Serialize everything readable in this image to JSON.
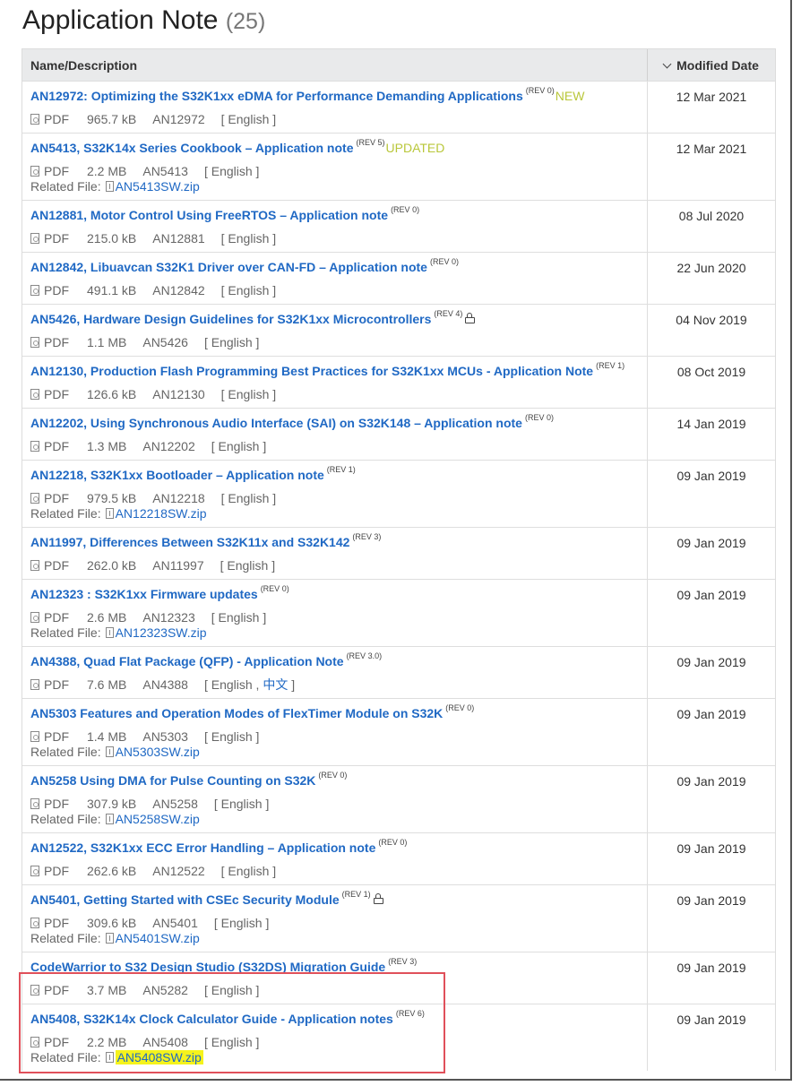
{
  "page": {
    "title": "Application Note",
    "count": "(25)"
  },
  "table": {
    "col_name": "Name/Description",
    "col_date": "Modified Date",
    "rows": [
      {
        "title": "AN12972: Optimizing the S32K1xx eDMA for Performance Demanding Applications",
        "rev": "(REV 0)",
        "badge": "NEW",
        "type": "PDF",
        "size": "965.7 kB",
        "code": "AN12972",
        "lang": "[ English ]",
        "related": "",
        "date": "12 Mar 2021"
      },
      {
        "title": "AN5413, S32K14x Series Cookbook – Application note",
        "rev": "(REV 5)",
        "badge": "UPDATED",
        "type": "PDF",
        "size": "2.2 MB",
        "code": "AN5413",
        "lang": "[ English ]",
        "related": "AN5413SW.zip",
        "date": "12 Mar 2021"
      },
      {
        "title": "AN12881, Motor Control Using FreeRTOS – Application note",
        "rev": "(REV 0)",
        "badge": "",
        "type": "PDF",
        "size": "215.0 kB",
        "code": "AN12881",
        "lang": "[ English ]",
        "related": "",
        "date": "08 Jul 2020"
      },
      {
        "title": "AN12842, Libuavcan S32K1 Driver over CAN-FD – Application note",
        "rev": "(REV 0)",
        "badge": "",
        "type": "PDF",
        "size": "491.1 kB",
        "code": "AN12842",
        "lang": "[ English ]",
        "related": "",
        "date": "22 Jun 2020"
      },
      {
        "title": "AN5426, Hardware Design Guidelines for S32K1xx Microcontrollers",
        "rev": "(REV 4)",
        "badge": "",
        "lock": true,
        "type": "PDF",
        "size": "1.1 MB",
        "code": "AN5426",
        "lang": "[ English ]",
        "related": "",
        "date": "04 Nov 2019"
      },
      {
        "title": "AN12130, Production Flash Programming Best Practices for S32K1xx MCUs - Application Note",
        "rev": "(REV 1)",
        "badge": "",
        "type": "PDF",
        "size": "126.6 kB",
        "code": "AN12130",
        "lang": "[ English ]",
        "related": "",
        "date": "08 Oct 2019"
      },
      {
        "title": "AN12202, Using Synchronous Audio Interface (SAI) on S32K148 – Application note",
        "rev": "(REV 0)",
        "badge": "",
        "type": "PDF",
        "size": "1.3 MB",
        "code": "AN12202",
        "lang": "[ English ]",
        "related": "",
        "date": "14 Jan 2019"
      },
      {
        "title": "AN12218, S32K1xx Bootloader – Application note",
        "rev": "(REV 1)",
        "badge": "",
        "type": "PDF",
        "size": "979.5 kB",
        "code": "AN12218",
        "lang": "[ English ]",
        "related": "AN12218SW.zip",
        "date": "09 Jan 2019"
      },
      {
        "title": "AN11997, Differences Between S32K11x and S32K142",
        "rev": "(REV 3)",
        "badge": "",
        "type": "PDF",
        "size": "262.0 kB",
        "code": "AN11997",
        "lang": "[ English ]",
        "related": "",
        "date": "09 Jan 2019"
      },
      {
        "title": "AN12323 : S32K1xx Firmware updates",
        "rev": "(REV 0)",
        "badge": "",
        "type": "PDF",
        "size": "2.6 MB",
        "code": "AN12323",
        "lang": "[ English ]",
        "related": "AN12323SW.zip",
        "date": "09 Jan 2019"
      },
      {
        "title": "AN4388, Quad Flat Package (QFP) - Application Note",
        "rev": "(REV 3.0)",
        "badge": "",
        "type": "PDF",
        "size": "7.6 MB",
        "code": "AN4388",
        "lang": "[ English ,",
        "lang_extra": "中文",
        "lang_close": "]",
        "related": "",
        "date": "09 Jan 2019"
      },
      {
        "title": "AN5303 Features and Operation Modes of FlexTimer Module on S32K",
        "rev": "(REV 0)",
        "badge": "",
        "type": "PDF",
        "size": "1.4 MB",
        "code": "AN5303",
        "lang": "[ English ]",
        "related": "AN5303SW.zip",
        "date": "09 Jan 2019"
      },
      {
        "title": "AN5258 Using DMA for Pulse Counting on S32K",
        "rev": "(REV 0)",
        "badge": "",
        "type": "PDF",
        "size": "307.9 kB",
        "code": "AN5258",
        "lang": "[ English ]",
        "related": "AN5258SW.zip",
        "date": "09 Jan 2019"
      },
      {
        "title": "AN12522, S32K1xx ECC Error Handling – Application note",
        "rev": "(REV 0)",
        "badge": "",
        "type": "PDF",
        "size": "262.6 kB",
        "code": "AN12522",
        "lang": "[ English ]",
        "related": "",
        "date": "09 Jan 2019"
      },
      {
        "title": "AN5401, Getting Started with CSEc Security Module",
        "rev": "(REV 1)",
        "badge": "",
        "lock": true,
        "type": "PDF",
        "size": "309.6 kB",
        "code": "AN5401",
        "lang": "[ English ]",
        "related": "AN5401SW.zip",
        "date": "09 Jan 2019"
      },
      {
        "title": "CodeWarrior to S32 Design Studio (S32DS) Migration Guide",
        "rev": "(REV 3)",
        "badge": "",
        "type": "PDF",
        "size": "3.7 MB",
        "code": "AN5282",
        "lang": "[ English ]",
        "related": "",
        "date": "09 Jan 2019"
      },
      {
        "title": "AN5408, S32K14x Clock Calculator Guide - Application notes",
        "rev": "(REV 6)",
        "badge": "",
        "type": "PDF",
        "size": "2.2 MB",
        "code": "AN5408",
        "lang": "[ English ]",
        "related": "AN5408SW.zip",
        "related_highlight": true,
        "date": "09 Jan 2019"
      }
    ],
    "related_label": "Related File:"
  },
  "colors": {
    "link": "#2069c4",
    "badge": "#b9c73a",
    "highlight": "#f5f31c",
    "callout_box": "#e0505a",
    "header_bg": "#e9eaeb"
  },
  "icons": {
    "pdf": "pdf-file-icon",
    "zip": "zip-file-icon",
    "lock": "lock-icon",
    "sort": "chevron-down-icon"
  }
}
